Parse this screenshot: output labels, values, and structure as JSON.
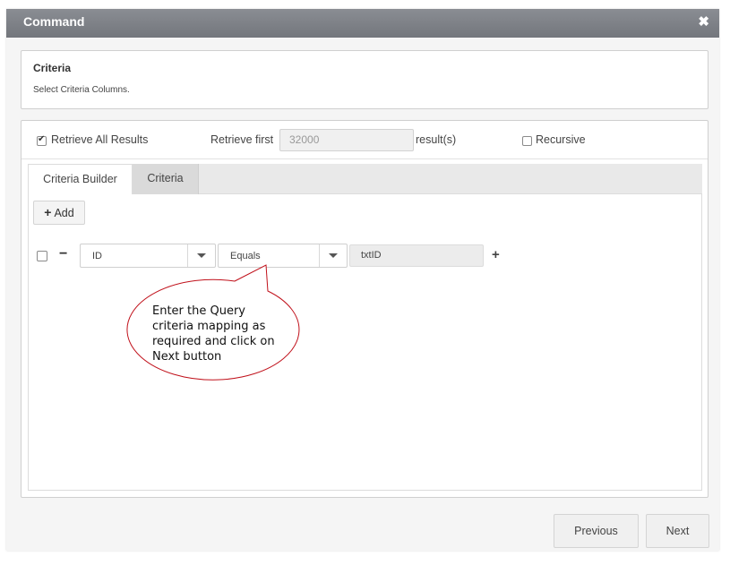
{
  "dialog": {
    "title": "Command",
    "close_glyph": "✖"
  },
  "info": {
    "title": "Criteria",
    "description": "Select Criteria Columns."
  },
  "options": {
    "retrieve_all": {
      "label": "Retrieve All Results",
      "checked": true
    },
    "retrieve_first_label": "Retrieve first",
    "retrieve_first_value": "32000",
    "results_suffix": "result(s)",
    "recursive": {
      "label": "Recursive",
      "checked": false
    }
  },
  "tabs": [
    {
      "label": "Criteria Builder",
      "active": true
    },
    {
      "label": "Criteria",
      "active": false
    }
  ],
  "builder": {
    "add_label": "Add",
    "row": {
      "field_value": "ID",
      "operator_value": "Equals",
      "input_value": "txtID"
    }
  },
  "callout": {
    "lines": [
      "Enter the Query",
      "criteria mapping as",
      "required and click on",
      "Next button"
    ],
    "stroke_color": "#c0101a"
  },
  "footer": {
    "previous_label": "Previous",
    "next_label": "Next"
  }
}
